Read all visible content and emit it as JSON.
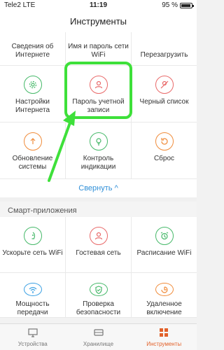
{
  "status": {
    "carrier": "Tele2 LTE",
    "time": "11:19",
    "battery_text": "95 %",
    "battery_level": 0.95
  },
  "header": {
    "title": "Инструменты"
  },
  "tools": [
    {
      "label": "Сведения об Интернете",
      "icon": "globe-icon",
      "color": "#3aa0e3"
    },
    {
      "label": "Имя и пароль сети WiFi",
      "icon": "wifi-icon",
      "color": "#3aa0e3"
    },
    {
      "label": "Перезагрузить",
      "icon": "power-icon",
      "color": "#3aa0e3"
    },
    {
      "label": "Настройки Интернета",
      "icon": "gear-icon",
      "color": "#47b96a"
    },
    {
      "label": "Пароль учетной записи",
      "icon": "user-icon",
      "color": "#e96a6a"
    },
    {
      "label": "Черный список",
      "icon": "blacklist-icon",
      "color": "#e96a6a"
    },
    {
      "label": "Обновление системы",
      "icon": "upgrade-icon",
      "color": "#f08c3b"
    },
    {
      "label": "Контроль индикации",
      "icon": "bulb-icon",
      "color": "#47b96a"
    },
    {
      "label": "Сброс",
      "icon": "reset-icon",
      "color": "#f08c3b"
    }
  ],
  "collapse_label": "Свернуть ^",
  "smart_section": {
    "title": "Смарт-приложения"
  },
  "smart_apps": [
    {
      "label": "Ускорьте сеть WiFi",
      "icon": "rocket-icon",
      "color": "#47b96a"
    },
    {
      "label": "Гостевая сеть",
      "icon": "guest-icon",
      "color": "#e96a6a"
    },
    {
      "label": "Расписание WiFi",
      "icon": "alarm-icon",
      "color": "#47b96a"
    },
    {
      "label": "Мощность передачи",
      "icon": "signal-icon",
      "color": "#3aa0e3"
    },
    {
      "label": "Проверка безопасности",
      "icon": "shield-icon",
      "color": "#47b96a"
    },
    {
      "label": "Удаленное включение",
      "icon": "remote-icon",
      "color": "#f08c3b"
    }
  ],
  "tabs": [
    {
      "label": "Устройства",
      "icon": "monitor-icon",
      "active": false
    },
    {
      "label": "Хранилище",
      "icon": "storage-icon",
      "active": false
    },
    {
      "label": "Инструменты",
      "icon": "tools-icon",
      "active": true
    }
  ],
  "colors": {
    "accent": "#2f8fd8",
    "active_tab": "#e2612a",
    "annotation": "#3ee03a"
  }
}
